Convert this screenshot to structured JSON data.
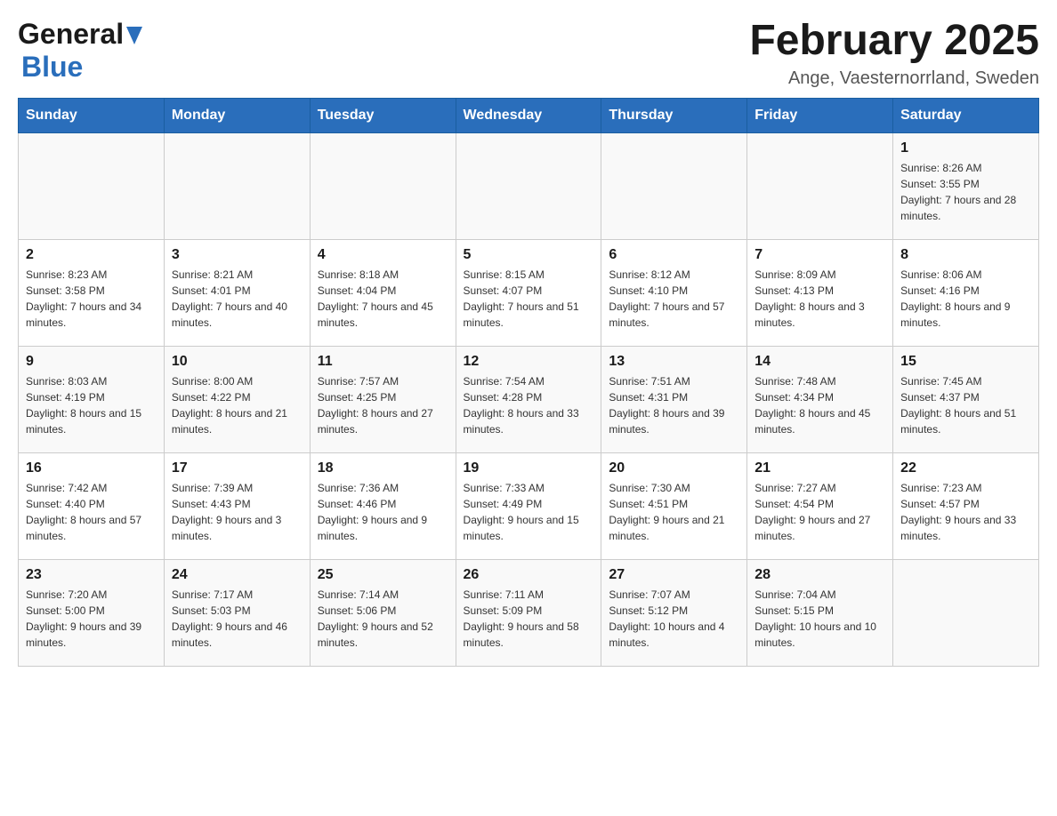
{
  "header": {
    "title": "February 2025",
    "subtitle": "Ange, Vaesternorrland, Sweden",
    "logo_general": "General",
    "logo_blue": "Blue"
  },
  "weekdays": [
    "Sunday",
    "Monday",
    "Tuesday",
    "Wednesday",
    "Thursday",
    "Friday",
    "Saturday"
  ],
  "weeks": [
    [
      {
        "day": "",
        "sunrise": "",
        "sunset": "",
        "daylight": ""
      },
      {
        "day": "",
        "sunrise": "",
        "sunset": "",
        "daylight": ""
      },
      {
        "day": "",
        "sunrise": "",
        "sunset": "",
        "daylight": ""
      },
      {
        "day": "",
        "sunrise": "",
        "sunset": "",
        "daylight": ""
      },
      {
        "day": "",
        "sunrise": "",
        "sunset": "",
        "daylight": ""
      },
      {
        "day": "",
        "sunrise": "",
        "sunset": "",
        "daylight": ""
      },
      {
        "day": "1",
        "sunrise": "Sunrise: 8:26 AM",
        "sunset": "Sunset: 3:55 PM",
        "daylight": "Daylight: 7 hours and 28 minutes."
      }
    ],
    [
      {
        "day": "2",
        "sunrise": "Sunrise: 8:23 AM",
        "sunset": "Sunset: 3:58 PM",
        "daylight": "Daylight: 7 hours and 34 minutes."
      },
      {
        "day": "3",
        "sunrise": "Sunrise: 8:21 AM",
        "sunset": "Sunset: 4:01 PM",
        "daylight": "Daylight: 7 hours and 40 minutes."
      },
      {
        "day": "4",
        "sunrise": "Sunrise: 8:18 AM",
        "sunset": "Sunset: 4:04 PM",
        "daylight": "Daylight: 7 hours and 45 minutes."
      },
      {
        "day": "5",
        "sunrise": "Sunrise: 8:15 AM",
        "sunset": "Sunset: 4:07 PM",
        "daylight": "Daylight: 7 hours and 51 minutes."
      },
      {
        "day": "6",
        "sunrise": "Sunrise: 8:12 AM",
        "sunset": "Sunset: 4:10 PM",
        "daylight": "Daylight: 7 hours and 57 minutes."
      },
      {
        "day": "7",
        "sunrise": "Sunrise: 8:09 AM",
        "sunset": "Sunset: 4:13 PM",
        "daylight": "Daylight: 8 hours and 3 minutes."
      },
      {
        "day": "8",
        "sunrise": "Sunrise: 8:06 AM",
        "sunset": "Sunset: 4:16 PM",
        "daylight": "Daylight: 8 hours and 9 minutes."
      }
    ],
    [
      {
        "day": "9",
        "sunrise": "Sunrise: 8:03 AM",
        "sunset": "Sunset: 4:19 PM",
        "daylight": "Daylight: 8 hours and 15 minutes."
      },
      {
        "day": "10",
        "sunrise": "Sunrise: 8:00 AM",
        "sunset": "Sunset: 4:22 PM",
        "daylight": "Daylight: 8 hours and 21 minutes."
      },
      {
        "day": "11",
        "sunrise": "Sunrise: 7:57 AM",
        "sunset": "Sunset: 4:25 PM",
        "daylight": "Daylight: 8 hours and 27 minutes."
      },
      {
        "day": "12",
        "sunrise": "Sunrise: 7:54 AM",
        "sunset": "Sunset: 4:28 PM",
        "daylight": "Daylight: 8 hours and 33 minutes."
      },
      {
        "day": "13",
        "sunrise": "Sunrise: 7:51 AM",
        "sunset": "Sunset: 4:31 PM",
        "daylight": "Daylight: 8 hours and 39 minutes."
      },
      {
        "day": "14",
        "sunrise": "Sunrise: 7:48 AM",
        "sunset": "Sunset: 4:34 PM",
        "daylight": "Daylight: 8 hours and 45 minutes."
      },
      {
        "day": "15",
        "sunrise": "Sunrise: 7:45 AM",
        "sunset": "Sunset: 4:37 PM",
        "daylight": "Daylight: 8 hours and 51 minutes."
      }
    ],
    [
      {
        "day": "16",
        "sunrise": "Sunrise: 7:42 AM",
        "sunset": "Sunset: 4:40 PM",
        "daylight": "Daylight: 8 hours and 57 minutes."
      },
      {
        "day": "17",
        "sunrise": "Sunrise: 7:39 AM",
        "sunset": "Sunset: 4:43 PM",
        "daylight": "Daylight: 9 hours and 3 minutes."
      },
      {
        "day": "18",
        "sunrise": "Sunrise: 7:36 AM",
        "sunset": "Sunset: 4:46 PM",
        "daylight": "Daylight: 9 hours and 9 minutes."
      },
      {
        "day": "19",
        "sunrise": "Sunrise: 7:33 AM",
        "sunset": "Sunset: 4:49 PM",
        "daylight": "Daylight: 9 hours and 15 minutes."
      },
      {
        "day": "20",
        "sunrise": "Sunrise: 7:30 AM",
        "sunset": "Sunset: 4:51 PM",
        "daylight": "Daylight: 9 hours and 21 minutes."
      },
      {
        "day": "21",
        "sunrise": "Sunrise: 7:27 AM",
        "sunset": "Sunset: 4:54 PM",
        "daylight": "Daylight: 9 hours and 27 minutes."
      },
      {
        "day": "22",
        "sunrise": "Sunrise: 7:23 AM",
        "sunset": "Sunset: 4:57 PM",
        "daylight": "Daylight: 9 hours and 33 minutes."
      }
    ],
    [
      {
        "day": "23",
        "sunrise": "Sunrise: 7:20 AM",
        "sunset": "Sunset: 5:00 PM",
        "daylight": "Daylight: 9 hours and 39 minutes."
      },
      {
        "day": "24",
        "sunrise": "Sunrise: 7:17 AM",
        "sunset": "Sunset: 5:03 PM",
        "daylight": "Daylight: 9 hours and 46 minutes."
      },
      {
        "day": "25",
        "sunrise": "Sunrise: 7:14 AM",
        "sunset": "Sunset: 5:06 PM",
        "daylight": "Daylight: 9 hours and 52 minutes."
      },
      {
        "day": "26",
        "sunrise": "Sunrise: 7:11 AM",
        "sunset": "Sunset: 5:09 PM",
        "daylight": "Daylight: 9 hours and 58 minutes."
      },
      {
        "day": "27",
        "sunrise": "Sunrise: 7:07 AM",
        "sunset": "Sunset: 5:12 PM",
        "daylight": "Daylight: 10 hours and 4 minutes."
      },
      {
        "day": "28",
        "sunrise": "Sunrise: 7:04 AM",
        "sunset": "Sunset: 5:15 PM",
        "daylight": "Daylight: 10 hours and 10 minutes."
      },
      {
        "day": "",
        "sunrise": "",
        "sunset": "",
        "daylight": ""
      }
    ]
  ]
}
